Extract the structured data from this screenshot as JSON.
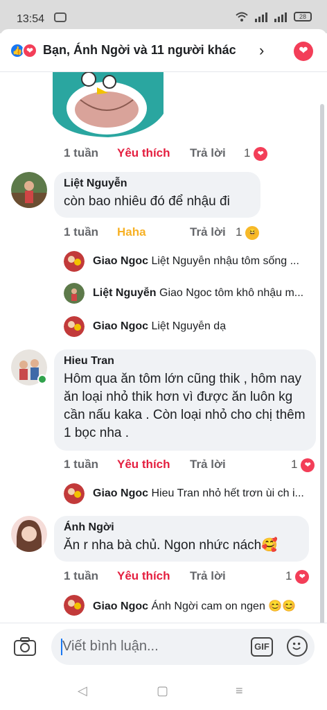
{
  "status_bar": {
    "time": "13:54",
    "battery": "28"
  },
  "header": {
    "title": "Bạn, Ánh Ngời và 11 người khác",
    "like_glyph": "👍",
    "love_glyph": "❤",
    "chevron": "›"
  },
  "top_actions": {
    "time": "1 tuần",
    "reaction": "Yêu thích",
    "reply": "Trả lời",
    "count": "1"
  },
  "comments": [
    {
      "name": "Liệt Nguyễn",
      "text": "còn bao nhiêu đó để nhậu đi",
      "actions": {
        "time": "1 tuần",
        "reaction": "Haha",
        "reply": "Trả lời",
        "count": "1"
      },
      "replies": [
        {
          "name": "Giao Ngoc",
          "text": "Liệt Nguyễn nhậu tôm sống ..."
        },
        {
          "name": "Liệt Nguyễn",
          "text": "Giao Ngoc tôm khô nhậu m..."
        },
        {
          "name": "Giao Ngoc",
          "text": "Liệt Nguyễn dạ"
        }
      ]
    },
    {
      "name": "Hieu Tran",
      "text": "Hôm qua ăn tôm lớn cũng thik , hôm nay ăn loại nhỏ thik hơn vì được ăn luôn kg cần nấu kaka . Còn loại nhỏ cho chị thêm 1 bọc nha .",
      "actions": {
        "time": "1 tuần",
        "reaction": "Yêu thích",
        "reply": "Trả lời",
        "count": "1"
      },
      "replies": [
        {
          "name": "Giao Ngoc",
          "text": "Hieu Tran nhỏ hết trơn ùi ch i..."
        }
      ]
    },
    {
      "name": "Ánh Ngời",
      "text": "Ăn r nha bà chủ. Ngon nhức nách🥰",
      "actions": {
        "time": "1 tuần",
        "reaction": "Yêu thích",
        "reply": "Trả lời",
        "count": "1"
      },
      "replies": [
        {
          "name": "Giao Ngoc",
          "text": "Ánh Ngời cam on ngen 😊😊"
        }
      ]
    }
  ],
  "composer": {
    "placeholder": "Viết bình luận...",
    "gif_label": "GIF"
  },
  "nav": {
    "back": "◁",
    "home": "▢",
    "menu": "≡"
  },
  "colors": {
    "like_red": "#e41e3f",
    "haha_yellow": "#f7b125",
    "fb_blue": "#1877f2",
    "bubble_gray": "#f0f2f5"
  }
}
